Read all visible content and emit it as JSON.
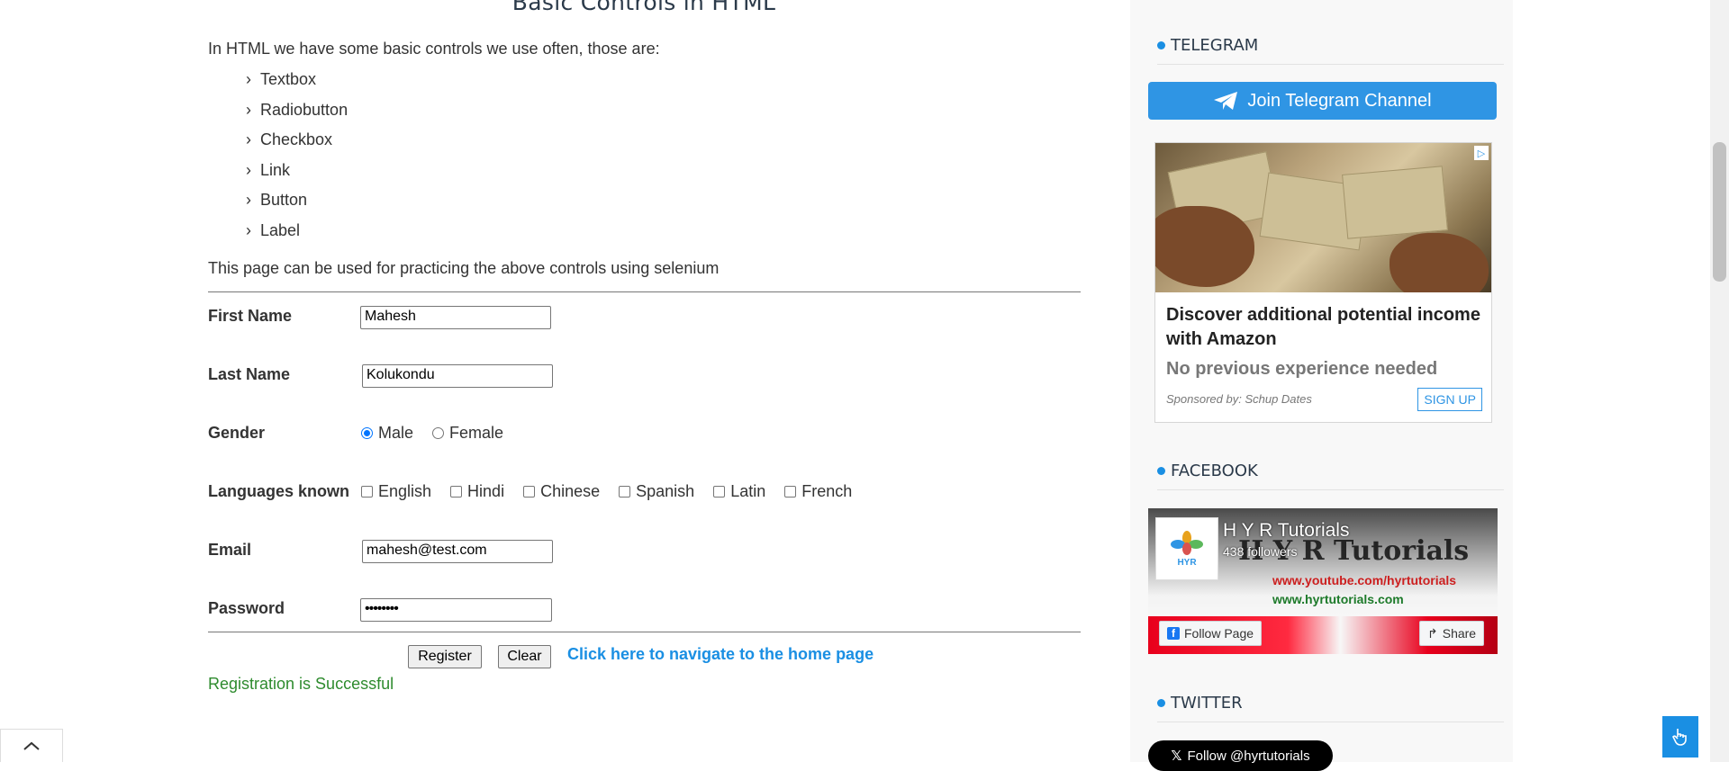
{
  "main": {
    "title": "Basic Controls in HTML",
    "intro": "In HTML we have some basic controls we use often, those are:",
    "controls": [
      "Textbox",
      "Radiobutton",
      "Checkbox",
      "Link",
      "Button",
      "Label"
    ],
    "practice_note": "This page can be used for practicing the above controls using selenium"
  },
  "form": {
    "first_name_label": "First Name",
    "first_name_value": "Mahesh",
    "last_name_label": "Last Name",
    "last_name_value": "Kolukondu",
    "gender_label": "Gender",
    "gender_options": [
      "Male",
      "Female"
    ],
    "gender_selected": "Male",
    "languages_label": "Languages known",
    "languages": [
      "English",
      "Hindi",
      "Chinese",
      "Spanish",
      "Latin",
      "French"
    ],
    "email_label": "Email",
    "email_value": "mahesh@test.com",
    "password_label": "Password",
    "password_value": "••••••••",
    "register_label": "Register",
    "clear_label": "Clear",
    "home_link": "Click here to navigate to the home page",
    "success_message": "Registration is Successful"
  },
  "sidebar": {
    "telegram_title": "TELEGRAM",
    "telegram_button": "Join Telegram Channel",
    "ad": {
      "headline": "Discover additional potential income with Amazon",
      "subline": "No previous experience needed",
      "sponsor": "Sponsored by: Schup Dates",
      "cta": "SIGN UP"
    },
    "facebook_title": "FACEBOOK",
    "facebook": {
      "page_name": "H Y R Tutorials",
      "followers": "438 followers",
      "banner_name": "H Y R Tutorials",
      "url1": "www.youtube.com/hyrtutorials",
      "url2": "www.hyrtutorials.com",
      "logo_text": "HYR",
      "follow_label": "Follow Page",
      "share_label": "Share"
    },
    "twitter_title": "TWITTER",
    "twitter_button": "Follow @hyrtutorials"
  },
  "colors": {
    "accent": "#1a8fe3",
    "telegram_button": "#2f95e4",
    "success": "#2e8b2e"
  }
}
